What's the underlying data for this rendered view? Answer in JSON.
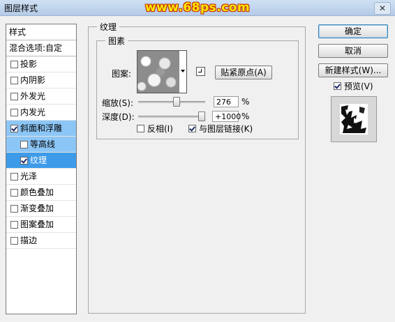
{
  "window": {
    "title": "图层样式",
    "watermark": "www.68ps.com",
    "close_glyph": "✕"
  },
  "sidebar": {
    "header": "样式",
    "blend_options": "混合选项:自定",
    "items": [
      {
        "label": "投影",
        "checked": false
      },
      {
        "label": "内阴影",
        "checked": false
      },
      {
        "label": "外发光",
        "checked": false
      },
      {
        "label": "内发光",
        "checked": false
      },
      {
        "label": "斜面和浮雕",
        "checked": true
      },
      {
        "label": "等高线",
        "checked": false
      },
      {
        "label": "纹理",
        "checked": true
      },
      {
        "label": "光泽",
        "checked": false
      },
      {
        "label": "颜色叠加",
        "checked": false
      },
      {
        "label": "渐变叠加",
        "checked": false
      },
      {
        "label": "图案叠加",
        "checked": false
      },
      {
        "label": "描边",
        "checked": false
      }
    ]
  },
  "texture_panel": {
    "group_title": "纹理",
    "subgroup_title": "图素",
    "pattern_label": "图案:",
    "snap_origin_button": "贴紧原点(A)",
    "scale": {
      "label": "缩放(S):",
      "value": "276",
      "unit": "%",
      "position": 0.58
    },
    "depth": {
      "label": "深度(D):",
      "value": "+1000",
      "unit": "%",
      "position": 1.0
    },
    "invert": {
      "label": "反相(I)",
      "checked": false
    },
    "link_with_layer": {
      "label": "与图层链接(K)",
      "checked": true
    }
  },
  "buttons": {
    "ok": "确定",
    "cancel": "取消",
    "new_style": "新建样式(W)...",
    "preview_label": "预览(V)",
    "preview_checked": true
  }
}
